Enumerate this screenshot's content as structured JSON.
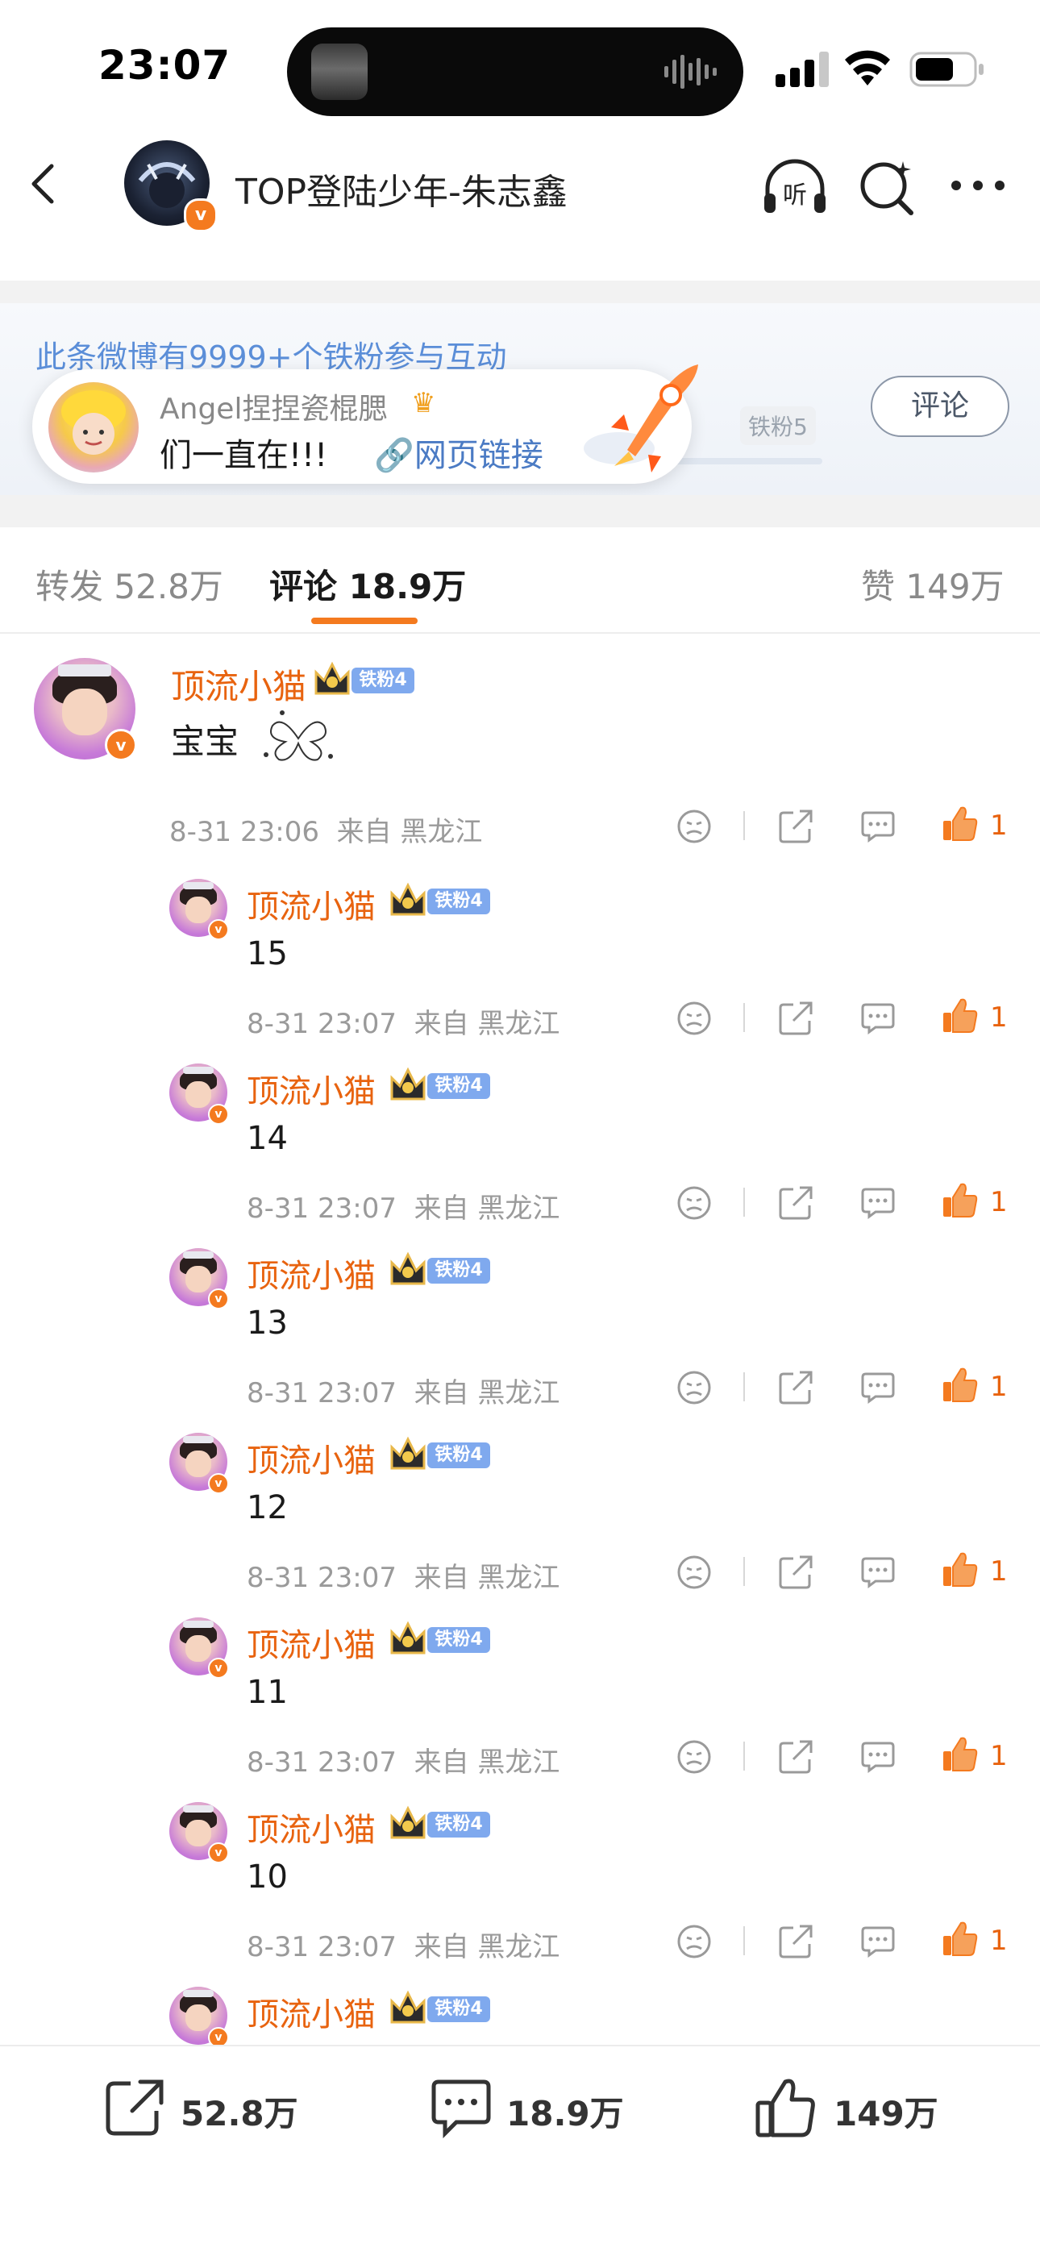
{
  "status_bar": {
    "time": "23:07"
  },
  "header": {
    "title": "TOP登陆少年-朱志鑫"
  },
  "fan_banner": {
    "title": "此条微博有9999+个铁粉参与互动",
    "level": "铁粉5",
    "comment_button": "评论",
    "toast": {
      "name": "Angel捏捏瓷棍腮",
      "text": "们一直在!!!",
      "link": "网页链接"
    }
  },
  "tabs": [
    {
      "label": "转发",
      "count": "52.8万"
    },
    {
      "label": "评论",
      "count": "18.9万"
    },
    {
      "label": "赞",
      "count": "149万"
    }
  ],
  "comment": {
    "user": "顶流小猫",
    "fan_tag": "铁粉4",
    "text": "宝宝",
    "time": "8-31 23:06",
    "from": "来自 黑龙江",
    "likes": "1"
  },
  "replies": [
    {
      "user": "顶流小猫",
      "fan_tag": "铁粉4",
      "text": "15",
      "time": "8-31 23:07",
      "from": "来自 黑龙江",
      "likes": "1"
    },
    {
      "user": "顶流小猫",
      "fan_tag": "铁粉4",
      "text": "14",
      "time": "8-31 23:07",
      "from": "来自 黑龙江",
      "likes": "1"
    },
    {
      "user": "顶流小猫",
      "fan_tag": "铁粉4",
      "text": "13",
      "time": "8-31 23:07",
      "from": "来自 黑龙江",
      "likes": "1"
    },
    {
      "user": "顶流小猫",
      "fan_tag": "铁粉4",
      "text": "12",
      "time": "8-31 23:07",
      "from": "来自 黑龙江",
      "likes": "1"
    },
    {
      "user": "顶流小猫",
      "fan_tag": "铁粉4",
      "text": "11",
      "time": "8-31 23:07",
      "from": "来自 黑龙江",
      "likes": "1"
    },
    {
      "user": "顶流小猫",
      "fan_tag": "铁粉4",
      "text": "10",
      "time": "8-31 23:07",
      "from": "来自 黑龙江",
      "likes": "1"
    },
    {
      "user": "顶流小猫",
      "fan_tag": "铁粉4"
    }
  ],
  "bottom_bar": {
    "repost": "52.8万",
    "comments": "18.9万",
    "likes": "149万"
  },
  "colors": {
    "accent": "#f47a1f",
    "username": "#e8630f",
    "link": "#4b7bc4",
    "fan_tag": "#7fa9ee"
  }
}
